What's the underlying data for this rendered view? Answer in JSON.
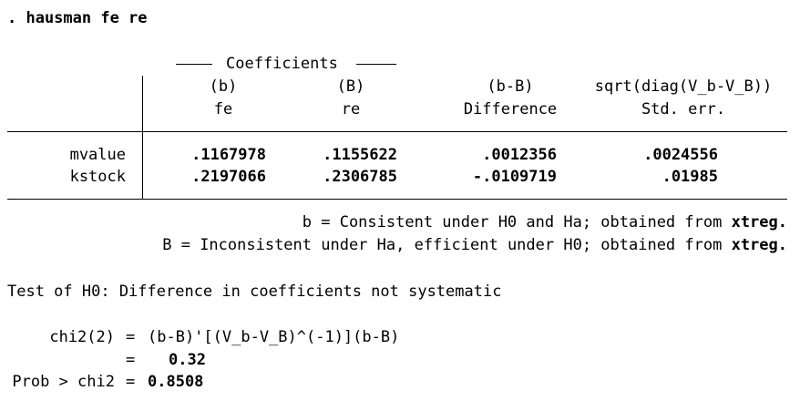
{
  "command": ". hausman fe re",
  "header": {
    "group_title": "Coefficients",
    "cols": [
      {
        "top": "(b)",
        "bottom": "fe"
      },
      {
        "top": "(B)",
        "bottom": "re"
      },
      {
        "top": "(b-B)",
        "bottom": "Difference"
      },
      {
        "top": "sqrt(diag(V_b-V_B))",
        "bottom": "Std. err."
      }
    ]
  },
  "rows": [
    {
      "name": "mvalue",
      "b": ".1167978",
      "B": ".1155622",
      "diff": ".0012356",
      "se": ".0024556"
    },
    {
      "name": "kstock",
      "b": ".2197066",
      "B": ".2306785",
      "diff": "-.0109719",
      "se": ".01985"
    }
  ],
  "notes": {
    "b_line_text": "b = Consistent under H0 and Ha; obtained from ",
    "b_line_cmd": "xtreg.",
    "B_line_text": "B = Inconsistent under Ha, efficient under H0; obtained from ",
    "B_line_cmd": "xtreg."
  },
  "test": {
    "title": "Test of H0: Difference in coefficients not systematic",
    "chi2_label": "chi2(2)",
    "eq": "=",
    "formula": "(b-B)'[(V_b-V_B)^(-1)](b-B)",
    "chi2_value": "0.32",
    "prob_label": "Prob > chi2",
    "prob_value": "0.8508"
  }
}
